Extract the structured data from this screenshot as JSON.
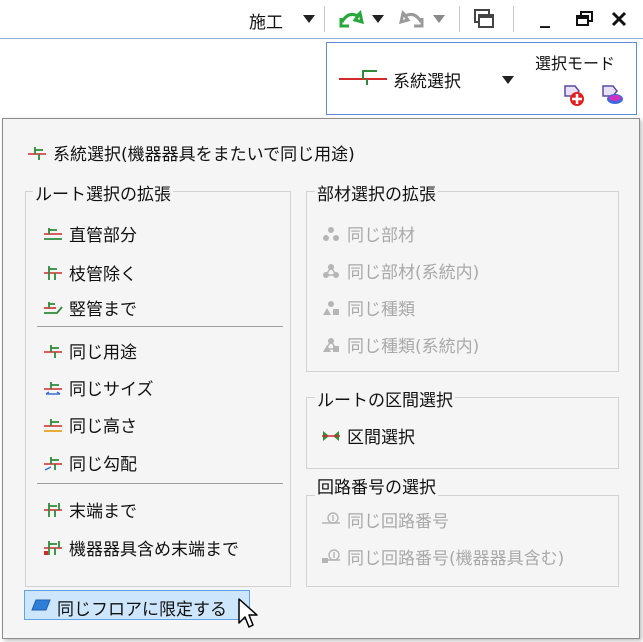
{
  "toolbar": {
    "mode_label": "施工",
    "window_controls": {
      "minimize": "_",
      "restore": "🗗",
      "close": "✕"
    }
  },
  "system_select": {
    "button_label": "系統選択",
    "mode_title": "選択モード"
  },
  "menu": {
    "top_item": "系統選択(機器器具をまたいで同じ用途)",
    "route_group": {
      "title": "ルート選択の拡張",
      "items": [
        "直管部分",
        "枝管除く",
        "竪管まで"
      ],
      "items2": [
        "同じ用途",
        "同じサイズ",
        "同じ高さ",
        "同じ勾配"
      ],
      "items3": [
        "末端まで",
        "機器器具含め末端まで"
      ]
    },
    "member_group": {
      "title": "部材選択の拡張",
      "items": [
        "同じ部材",
        "同じ部材(系統内)",
        "同じ種類",
        "同じ種類(系統内)"
      ]
    },
    "section_group": {
      "title": "ルートの区間選択",
      "items": [
        "区間選択"
      ]
    },
    "circuit_group": {
      "title": "回路番号の選択",
      "items": [
        "同じ回路番号",
        "同じ回路番号(機器器具含む)"
      ]
    },
    "floor_button": "同じフロアに限定する"
  },
  "colors": {
    "accent_blue": "#5b8ed6",
    "hover_fill": "#cde6fb",
    "disabled_text": "#a9a9a9",
    "icon_green": "#2e8b3a",
    "icon_red": "#d22a2a"
  }
}
